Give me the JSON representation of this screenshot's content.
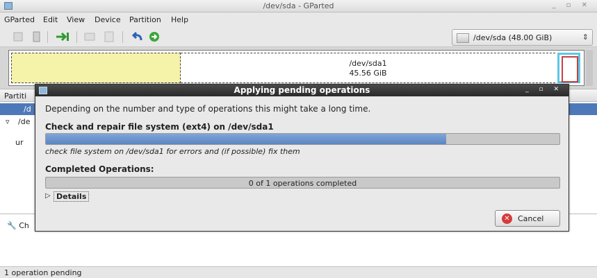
{
  "window": {
    "title": "/dev/sda - GParted",
    "controls": "_ ▫ ✕"
  },
  "menu": [
    "GParted",
    "Edit",
    "View",
    "Device",
    "Partition",
    "Help"
  ],
  "toolbar": {
    "device": "/dev/sda  (48.00 GiB)"
  },
  "diskmap": {
    "partition_name": "/dev/sda1",
    "partition_size": "45.56 GiB"
  },
  "list": {
    "header": "Partiti",
    "rows": [
      "/d",
      "/de",
      "ur"
    ]
  },
  "lower_panel": {
    "item": "Ch"
  },
  "statusbar": {
    "text": "1 operation pending"
  },
  "dialog": {
    "title": "Applying pending operations",
    "description": "Depending on the number and type of operations this might take a long time.",
    "current_operation": "Check and repair file system (ext4) on /dev/sda1",
    "operation_progress": 0.78,
    "current_suboperation": "check file system on /dev/sda1 for errors and (if possible) fix them",
    "completed_heading": "Completed Operations:",
    "completed_text": "0 of 1 operations completed",
    "completed_progress": 0,
    "details_label": "Details",
    "cancel_label": "Cancel"
  },
  "colors": {
    "selection": "#4d79b8",
    "progress": "#6b93cc",
    "partition_ext4": "#f5f2aa",
    "cancel_icon": "#d63a3a"
  }
}
